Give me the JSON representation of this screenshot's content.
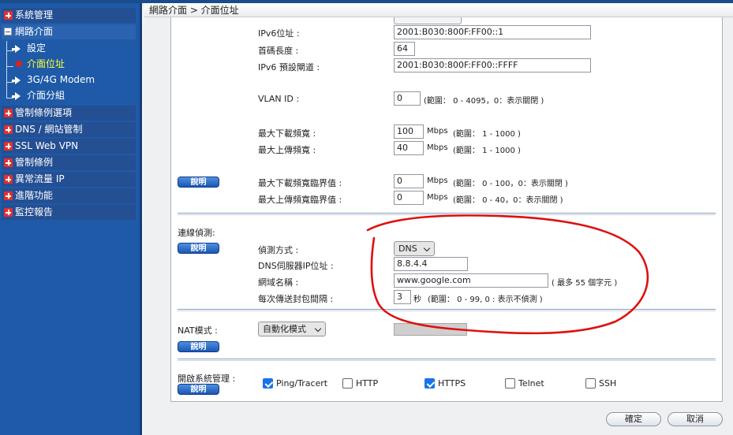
{
  "sidebar": {
    "items": [
      {
        "label": "系統管理",
        "state": "collapsed"
      },
      {
        "label": "網路介面",
        "state": "expanded"
      },
      {
        "label": "設定"
      },
      {
        "label": "介面位址",
        "active": true
      },
      {
        "label": "3G/4G Modem"
      },
      {
        "label": "介面分組"
      },
      {
        "label": "管制條例選項",
        "state": "collapsed"
      },
      {
        "label": "DNS / 網站管制",
        "state": "collapsed"
      },
      {
        "label": "SSL Web VPN",
        "state": "collapsed"
      },
      {
        "label": "管制條例",
        "state": "collapsed"
      },
      {
        "label": "異常流量 IP",
        "state": "collapsed"
      },
      {
        "label": "進階功能",
        "state": "collapsed"
      },
      {
        "label": "監控報告",
        "state": "collapsed"
      }
    ]
  },
  "breadcrumb": "網路介面 > 介面位址",
  "ipv6": {
    "address_label": "IPv6位址 :",
    "address_value": "2001:B030:800F:FF00::1",
    "prefix_label": "首碼長度 :",
    "prefix_value": "64",
    "gateway_label": "IPv6 預設閘道 :",
    "gateway_value": "2001:B030:800F:FF00::FFFF"
  },
  "vlan": {
    "label": "VLAN ID :",
    "value": "0",
    "hint": "(範圍： 0 - 4095，0：表示關閉 )"
  },
  "bandwidth": {
    "down_label": "最大下載頻寬 :",
    "down_value": "100",
    "down_unit": "Mbps",
    "down_hint": "(範圍： 1 - 1000 )",
    "up_label": "最大上傳頻寬 :",
    "up_value": "40",
    "up_unit": "Mbps",
    "up_hint": "(範圍： 1 - 1000 )"
  },
  "threshold": {
    "help": "說明",
    "down_label": "最大下載頻寬臨界值 :",
    "down_value": "0",
    "down_unit": "Mbps",
    "down_hint": "(範圍： 0 - 100，0：表示關閉 )",
    "up_label": "最大上傳頻寬臨界值 :",
    "up_value": "0",
    "up_unit": "Mbps",
    "up_hint": "(範圍： 0 - 40，0：表示關閉 )"
  },
  "detection": {
    "section_label": "連線偵測:",
    "help": "說明",
    "method_label": "偵測方式 :",
    "method_value": "DNS",
    "dns_ip_label": "DNS伺服器IP位址 :",
    "dns_ip_value": "8.8.4.4",
    "domain_label": "網域名稱 :",
    "domain_value": "www.google.com",
    "domain_hint": "( 最多 55 個字元 )",
    "interval_label": "每次傳送封包間隔 :",
    "interval_value": "3",
    "interval_unit": "秒",
    "interval_hint": "(範圍： 0 - 99, 0 : 表示不偵測 )"
  },
  "nat": {
    "label": "NAT模式 :",
    "help": "說明",
    "mode_value": "自動化模式"
  },
  "mgmt": {
    "label": "開啟系統管理 :",
    "help": "說明",
    "options": [
      {
        "label": "Ping/Tracert",
        "checked": true
      },
      {
        "label": "HTTP",
        "checked": false
      },
      {
        "label": "HTTPS",
        "checked": true
      },
      {
        "label": "Telnet",
        "checked": false
      },
      {
        "label": "SSH",
        "checked": false
      }
    ]
  },
  "buttons": {
    "ok": "確定",
    "cancel": "取消"
  },
  "colors": {
    "sidebar": "#1e5aa8",
    "annotation": "#e01010",
    "accent": "#1a73e8"
  }
}
